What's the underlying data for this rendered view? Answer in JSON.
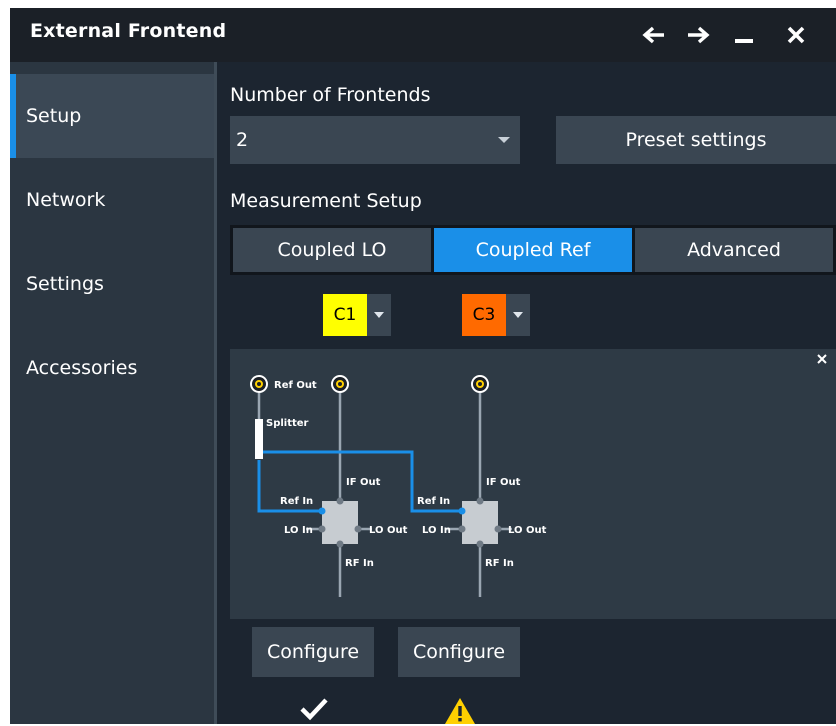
{
  "window": {
    "title": "External Frontend",
    "controls": [
      "back-arrow-icon",
      "forward-arrow-icon",
      "minimize-icon",
      "close-icon"
    ]
  },
  "sidebar": {
    "items": [
      {
        "label": "Setup",
        "active": true
      },
      {
        "label": "Network",
        "active": false
      },
      {
        "label": "Settings",
        "active": false
      },
      {
        "label": "Accessories",
        "active": false
      }
    ]
  },
  "main": {
    "frontends_label": "Number of Frontends",
    "frontends_value": "2",
    "preset_button": "Preset settings",
    "measurement_label": "Measurement Setup",
    "measurement_tabs": [
      {
        "label": "Coupled LO",
        "active": false
      },
      {
        "label": "Coupled Ref",
        "active": true
      },
      {
        "label": "Advanced",
        "active": false
      }
    ],
    "channels": [
      {
        "name": "C1",
        "color": "#ffff00"
      },
      {
        "name": "C3",
        "color": "#ff6a00"
      }
    ],
    "diagram": {
      "ref_out": "Ref Out",
      "splitter": "Splitter",
      "ref_in": "Ref In",
      "if_out": "IF Out",
      "lo_in": "LO In",
      "lo_out": "LO Out",
      "rf_in": "RF In"
    },
    "configure": [
      {
        "label": "Configure",
        "status": "check-icon"
      },
      {
        "label": "Configure",
        "status": "warning-icon"
      }
    ]
  },
  "colors": {
    "accent": "#1a8fe8",
    "warning": "#ffd000"
  }
}
